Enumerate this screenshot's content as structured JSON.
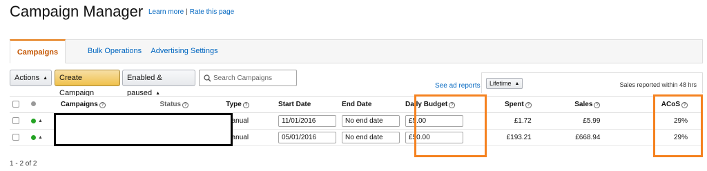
{
  "page": {
    "title": "Campaign Manager",
    "learn_more": "Learn more",
    "separator": "|",
    "rate_page": "Rate this page"
  },
  "tabs": [
    {
      "label": "Campaigns",
      "active": true
    },
    {
      "label": "Bulk Operations",
      "active": false
    },
    {
      "label": "Advertising Settings",
      "active": false
    }
  ],
  "toolbar": {
    "actions_label": "Actions",
    "create_label": "Create Campaign",
    "filter_label": "Enabled & paused",
    "search_placeholder": "Search Campaigns",
    "see_ad_reports": "See ad reports",
    "lifetime_label": "Lifetime",
    "sales_reported": "Sales reported within 48 hrs"
  },
  "table": {
    "headers": {
      "campaigns": "Campaigns",
      "status": "Status",
      "type": "Type",
      "start_date": "Start Date",
      "end_date": "End Date",
      "daily_budget": "Daily Budget",
      "spent": "Spent",
      "sales": "Sales",
      "acos": "ACoS"
    },
    "rows": [
      {
        "type": "Manual",
        "start_date": "11/01/2016",
        "end_date": "No end date",
        "daily_budget": "£5.00",
        "spent": "£1.72",
        "sales": "£5.99",
        "acos": "29%",
        "status_color": "#24a324"
      },
      {
        "type": "Manual",
        "start_date": "05/01/2016",
        "end_date": "No end date",
        "daily_budget": "£50.00",
        "spent": "£193.21",
        "sales": "£668.94",
        "acos": "29%",
        "status_color": "#24a324"
      }
    ]
  },
  "pager": {
    "label": "1 - 2 of 2"
  },
  "colors": {
    "accent": "#e47911",
    "link": "#0066c0",
    "highlight": "#f58220",
    "primary_button": "#f0c14b"
  }
}
